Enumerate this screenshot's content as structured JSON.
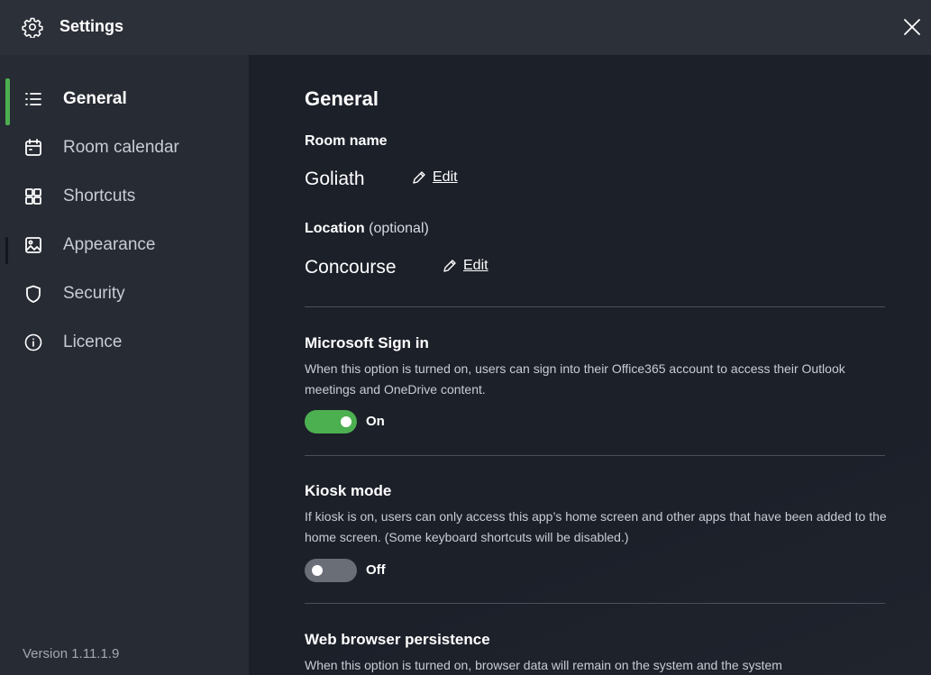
{
  "window": {
    "title": "Settings",
    "gear_icon": "gear-icon",
    "close_icon": "close-icon"
  },
  "sidebar": {
    "items": [
      {
        "label": "General",
        "icon": "list-icon",
        "active": true
      },
      {
        "label": "Room calendar",
        "icon": "calendar-icon",
        "active": false
      },
      {
        "label": "Shortcuts",
        "icon": "grid-icon",
        "active": false
      },
      {
        "label": "Appearance",
        "icon": "image-icon",
        "active": false
      },
      {
        "label": "Security",
        "icon": "shield-icon",
        "active": false
      },
      {
        "label": "Licence",
        "icon": "info-icon",
        "active": false
      }
    ],
    "version": "Version 1.11.1.9"
  },
  "main": {
    "section_title": "General",
    "room_name": {
      "label": "Room name",
      "value": "Goliath",
      "edit_label": "Edit"
    },
    "location": {
      "label": "Location",
      "label_optional": "(optional)",
      "value": "Concourse",
      "edit_label": "Edit"
    },
    "options": [
      {
        "title": "Microsoft Sign in",
        "description": "When this option is turned on, users can sign into their Office365 account to access their Outlook meetings and OneDrive content.",
        "state": "On"
      },
      {
        "title": "Kiosk mode",
        "description": "If kiosk is on, users can only access this app’s home screen and other apps that have been added to the home screen. (Some keyboard shortcuts will be disabled.)",
        "state": "Off"
      },
      {
        "title": "Web browser persistence",
        "description": "When this option is turned on, browser data will remain on the system and the system"
      }
    ]
  },
  "colors": {
    "accent_green": "#4caf50",
    "titlebar_bg": "#2c3039",
    "sidebar_bg": "#272b33",
    "content_bg": "#1c2029",
    "toggle_off": "#6a6e77"
  }
}
